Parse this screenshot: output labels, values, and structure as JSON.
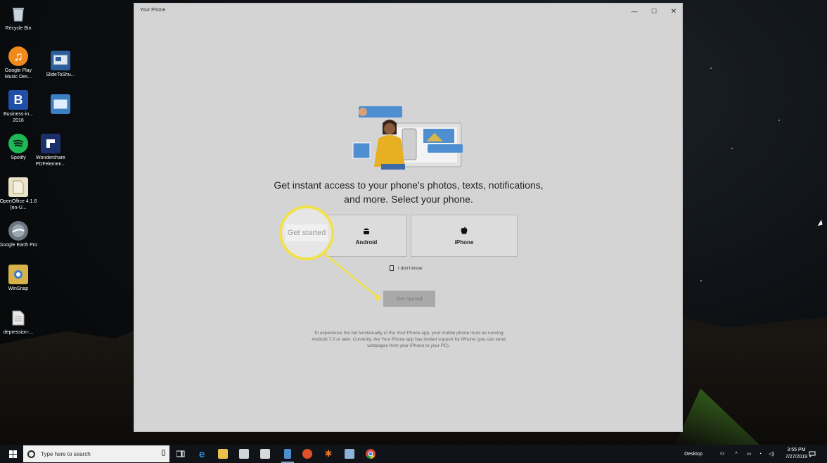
{
  "desktop": {
    "icons": [
      {
        "label": "Recycle Bin",
        "icon": "recycle-bin-icon"
      },
      {
        "label": "Google Play Music Des...",
        "icon": "google-play-music-icon"
      },
      {
        "label": "SlideToShu...",
        "icon": "slide-to-shutdown-icon"
      },
      {
        "label": "Business-in... 2016",
        "icon": "business-b-icon"
      },
      {
        "label": "",
        "icon": "app-icon"
      },
      {
        "label": "Spotify",
        "icon": "spotify-icon"
      },
      {
        "label": "Wondershare PDFelemen...",
        "icon": "pdfelement-icon"
      },
      {
        "label": "OpenOffice 4.1.6 (en-U...",
        "icon": "openoffice-icon"
      },
      {
        "label": "Google Earth Pro",
        "icon": "google-earth-icon"
      },
      {
        "label": "WinSnap",
        "icon": "winsnap-icon"
      },
      {
        "label": "depression-...",
        "icon": "document-icon"
      }
    ]
  },
  "window": {
    "title": "Your Phone",
    "controls": {
      "minimize": "—",
      "maximize": "☐",
      "close": "✕"
    }
  },
  "main": {
    "headline_line1": "Get instant access to your phone's photos, texts, notifications,",
    "headline_line2": "and more. Select your phone.",
    "options": [
      {
        "label": "Android",
        "icon": "android-icon"
      },
      {
        "label": "iPhone",
        "icon": "apple-icon"
      }
    ],
    "dont_know": "I don't know",
    "get_started": "Get started",
    "disclaimer": "To experience the full functionality of the Your Phone app, your mobile phone must be running Android 7.0 or later. Currently, the Your Phone app has limited support for iPhone (you can send webpages from your iPhone to your PC)."
  },
  "callout": {
    "text": "Get started",
    "color": "#f2e14a"
  },
  "taskbar": {
    "search_placeholder": "Type here to search",
    "desktop_label": "Desktop",
    "time": "3:55 PM",
    "date": "7/27/2019"
  }
}
